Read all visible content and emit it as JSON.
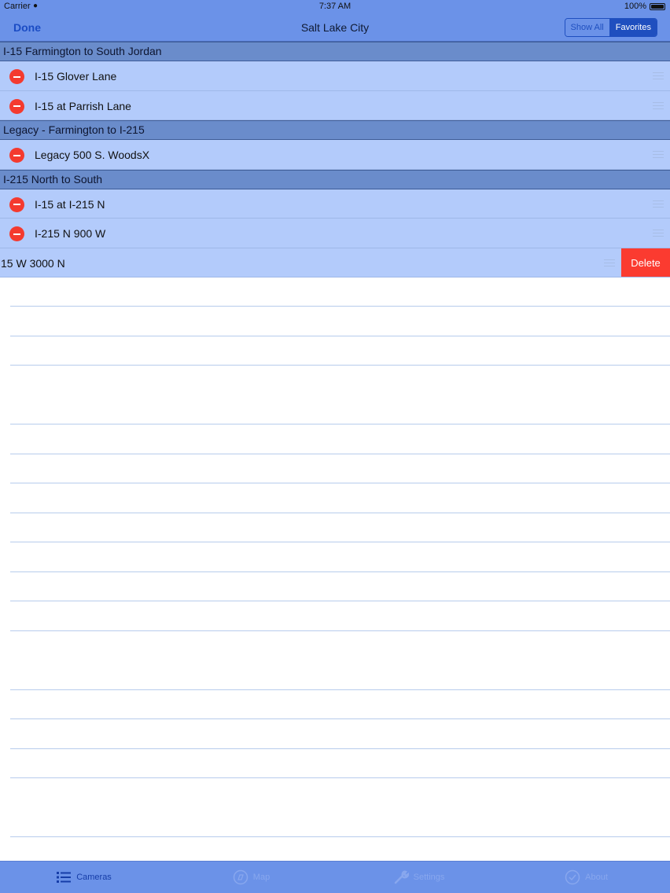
{
  "status_bar": {
    "carrier": "Carrier",
    "time": "7:37 AM",
    "battery": "100%"
  },
  "nav_bar": {
    "done_label": "Done",
    "title": "Salt Lake City",
    "segments": {
      "show_all": "Show All",
      "favorites": "Favorites"
    },
    "selected_segment": "Favorites"
  },
  "sections": [
    {
      "header": "I-15 Farmington to South Jordan",
      "rows": [
        {
          "label": "I-15 Glover Lane"
        },
        {
          "label": "I-15 at Parrish Lane"
        }
      ]
    },
    {
      "header": "Legacy - Farmington to I-215",
      "rows": [
        {
          "label": "Legacy 500 S. WoodsX"
        }
      ]
    },
    {
      "header": "I-215 North to South",
      "rows": [
        {
          "label": "I-15 at I-215 N"
        },
        {
          "label": "I-215 N 900 W"
        },
        {
          "label": "15 W 3000 N",
          "swiped": true,
          "delete_label": "Delete"
        }
      ]
    }
  ],
  "tab_bar": {
    "tabs": [
      {
        "label": "Cameras",
        "icon": "list-icon",
        "active": true
      },
      {
        "label": "Map",
        "icon": "map-icon",
        "active": false
      },
      {
        "label": "Settings",
        "icon": "wrench-icon",
        "active": false
      },
      {
        "label": "About",
        "icon": "info-icon",
        "active": false
      }
    ]
  },
  "colors": {
    "bar": "#6b92e8",
    "row": "#b3cbfb",
    "section_header": "#6a8ccb",
    "delete": "#fb3b30",
    "minus": "#f43a2f"
  }
}
